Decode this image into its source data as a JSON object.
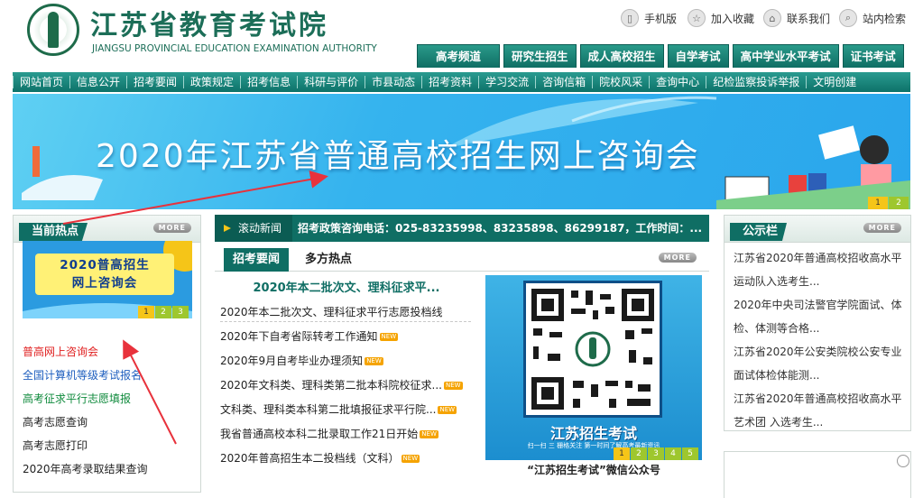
{
  "header": {
    "logo_cn": "江苏省教育考试院",
    "logo_en": "JIANGSU PROVINCIAL EDUCATION EXAMINATION AUTHORITY",
    "links": [
      "手机版",
      "加入收藏",
      "联系我们",
      "站内检索"
    ]
  },
  "tabs": [
    "高考频道",
    "研究生招生",
    "成人高校招生",
    "自学考试",
    "高中学业水平考试",
    "证书考试"
  ],
  "nav": [
    "网站首页",
    "信息公开",
    "招考要闻",
    "政策规定",
    "招考信息",
    "科研与评价",
    "市县动态",
    "招考资料",
    "学习交流",
    "咨询信箱",
    "院校风采",
    "查询中心",
    "纪检监察投诉举报",
    "文明创建"
  ],
  "banner": {
    "title": "2020年江苏省普通高校招生网上咨询会",
    "dots": [
      "1",
      "2"
    ]
  },
  "left": {
    "title": "当前热点",
    "more": "MORE",
    "image_text1": "2020普高招生",
    "image_text2": "网上咨询会",
    "dots": [
      "1",
      "2",
      "3"
    ],
    "items": [
      "普高网上咨询会",
      "全国计算机等级考试报名",
      "高考征求平行志愿填报",
      "高考志愿查询",
      "高考志愿打印",
      "2020年高考录取结果查询"
    ]
  },
  "scroll": {
    "label": "滚动新闻",
    "text": "招考政策咨询电话：025-83235998、83235898、86299187，工作时间：..."
  },
  "news": {
    "tabs": [
      "招考要闻",
      "多方热点"
    ],
    "more": "MORE",
    "headline": "2020年本二批次文、理科征求平...",
    "items": [
      "2020年本二批次文、理科征求平行志愿投档线",
      "2020年下自考省际转考工作通知",
      "2020年9月自考毕业办理须知",
      "2020年文科类、理科类第二批本科院校征求...",
      "文科类、理科类本科第二批填报征求平行院...",
      "我省普通高校本科二批录取工作21日开始",
      "2020年普高招生本二投档线（文科）"
    ],
    "new_tag": "NEW",
    "qr_title": "江苏招生考试",
    "qr_sub": "扫一扫 三 栅格关注  第一时间了解高考最新资讯",
    "qr_dots": [
      "1",
      "2",
      "3",
      "4",
      "5"
    ],
    "qr_caption": "“江苏招生考试”微信公众号"
  },
  "notice": {
    "title": "公示栏",
    "more": "MORE",
    "items": [
      "江苏省2020年普通高校招收高水平",
      "运动队入选考生...",
      "2020年中央司法警官学院面试、体",
      "检、体测等合格...",
      "江苏省2020年公安类院校公安专业",
      "面试体检体能测...",
      "江苏省2020年普通高校招收高水平",
      "艺术团 入选考生..."
    ]
  },
  "colors": {
    "primary": "#0f6e64",
    "accent": "#f5c518",
    "red_item": "#e02020",
    "blue_item": "#1f5fbf",
    "green_item": "#0f8a3c",
    "arrow": "#e8323c"
  }
}
